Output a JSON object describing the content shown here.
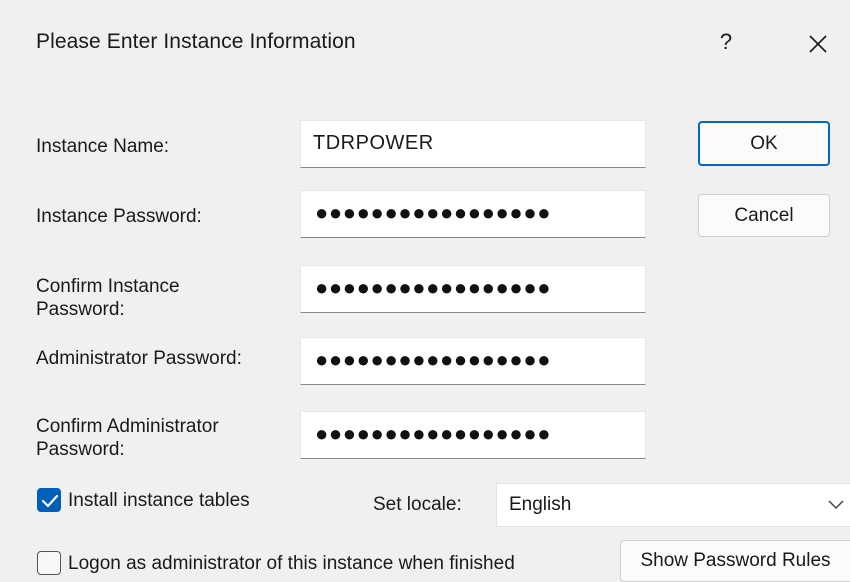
{
  "window": {
    "title": "Please Enter Instance Information",
    "help_glyph": "?",
    "close_icon": "close-icon"
  },
  "fields": {
    "instance_name": {
      "label": "Instance Name:",
      "value": "TDRPOWER"
    },
    "instance_password": {
      "label": "Instance Password:",
      "value": "●●●●●●●●●●●●●●●●●"
    },
    "confirm_instance_password": {
      "label_line1": "Confirm Instance",
      "label_line2": "Password:",
      "value": "●●●●●●●●●●●●●●●●●"
    },
    "admin_password": {
      "label": "Administrator Password:",
      "value": "●●●●●●●●●●●●●●●●●"
    },
    "confirm_admin_password": {
      "label_line1": "Confirm Administrator",
      "label_line2": "Password:",
      "value": "●●●●●●●●●●●●●●●●●"
    }
  },
  "buttons": {
    "ok": "OK",
    "cancel": "Cancel",
    "show_password_rules": "Show Password Rules"
  },
  "options": {
    "install_tables": {
      "label": "Install instance tables",
      "checked": true
    },
    "logon_admin": {
      "label": "Logon as administrator of this instance when finished",
      "checked": false
    },
    "locale": {
      "label": "Set locale:",
      "value": "English"
    }
  },
  "colors": {
    "accent": "#005fb8",
    "default_button_border": "#0067c0",
    "background": "#f0f0f0"
  }
}
